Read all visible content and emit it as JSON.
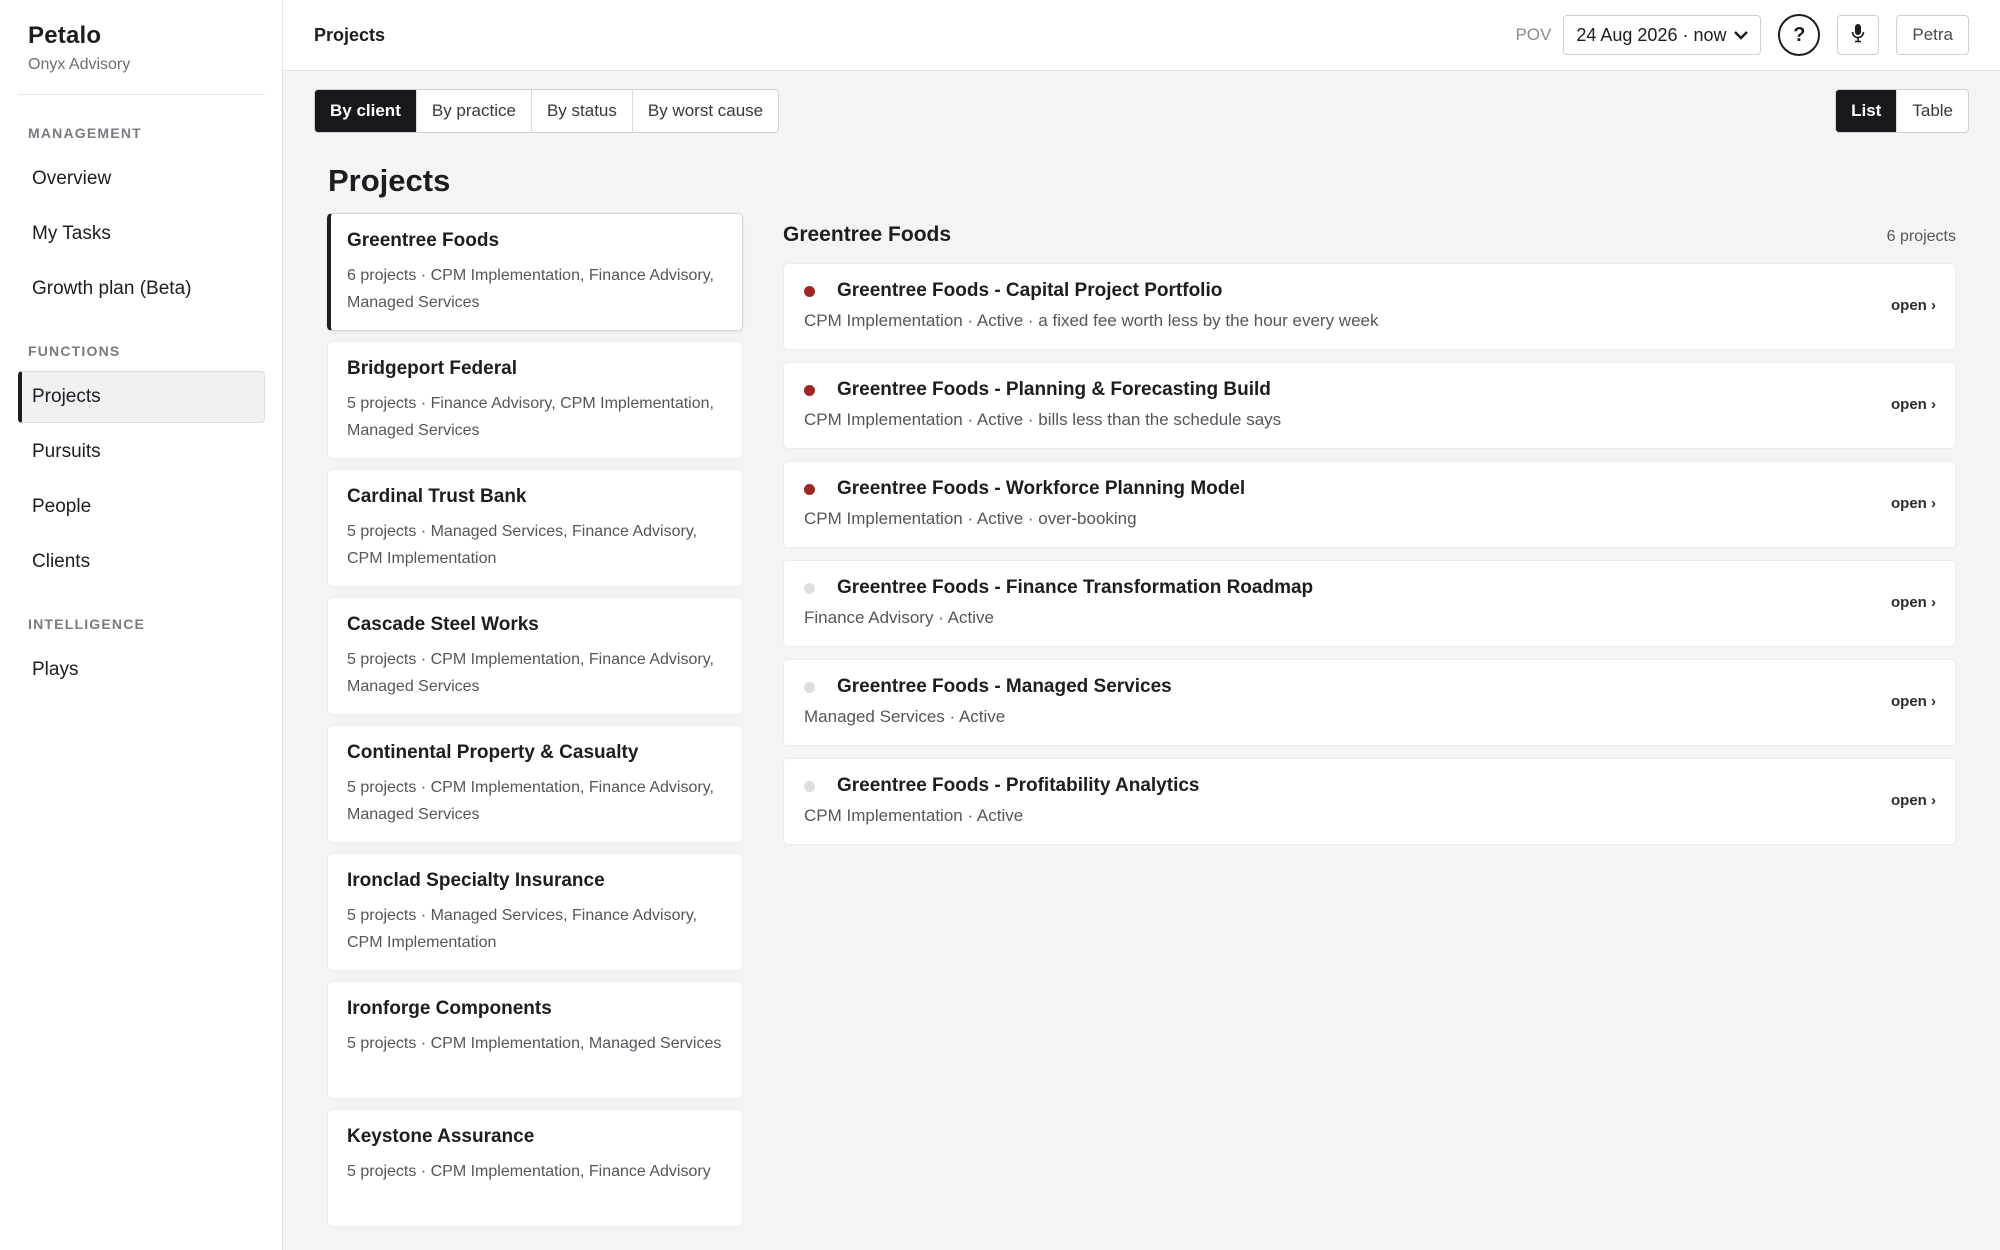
{
  "brand": {
    "name": "Petalo",
    "org": "Onyx Advisory"
  },
  "sidebar": {
    "sections": [
      {
        "title": "MANAGEMENT",
        "items": [
          "Overview",
          "My Tasks",
          "Growth plan (Beta)"
        ]
      },
      {
        "title": "FUNCTIONS",
        "items": [
          "Projects",
          "Pursuits",
          "People",
          "Clients"
        ]
      },
      {
        "title": "INTELLIGENCE",
        "items": [
          "Plays"
        ]
      }
    ],
    "active": "Projects"
  },
  "topbar": {
    "title": "Projects",
    "pov_label": "POV",
    "pov_value": "24 Aug 2026 · now",
    "help_label": "?",
    "user": "Petra"
  },
  "toolbar": {
    "group_tabs": [
      "By client",
      "By practice",
      "By status",
      "By worst cause"
    ],
    "group_active": "By client",
    "view_tabs": [
      "List",
      "Table"
    ],
    "view_active": "List"
  },
  "page_title": "Projects",
  "clients": [
    {
      "name": "Greentree Foods",
      "meta": "6 projects · CPM Implementation, Finance Advisory, Managed Services",
      "active": true
    },
    {
      "name": "Bridgeport Federal",
      "meta": "5 projects · Finance Advisory, CPM Implementation, Managed Services"
    },
    {
      "name": "Cardinal Trust Bank",
      "meta": "5 projects · Managed Services, Finance Advisory, CPM Implementation"
    },
    {
      "name": "Cascade Steel Works",
      "meta": "5 projects · CPM Implementation, Finance Advisory, Managed Services"
    },
    {
      "name": "Continental Property & Casualty",
      "meta": "5 projects · CPM Implementation, Finance Advisory, Managed Services"
    },
    {
      "name": "Ironclad Specialty Insurance",
      "meta": "5 projects · Managed Services, Finance Advisory, CPM Implementation"
    },
    {
      "name": "Ironforge Components",
      "meta": "5 projects · CPM Implementation, Managed Services"
    },
    {
      "name": "Keystone Assurance",
      "meta": "5 projects · CPM Implementation, Finance Advisory"
    }
  ],
  "detail": {
    "title": "Greentree Foods",
    "count": "6 projects",
    "open_label": "open ›",
    "projects": [
      {
        "name": "Greentree Foods - Capital Project Portfolio",
        "meta": "CPM Implementation · Active · a fixed fee worth less by the hour every week",
        "status": "red"
      },
      {
        "name": "Greentree Foods - Planning & Forecasting Build",
        "meta": "CPM Implementation · Active · bills less than the schedule says",
        "status": "red"
      },
      {
        "name": "Greentree Foods - Workforce Planning Model",
        "meta": "CPM Implementation · Active · over-booking",
        "status": "red"
      },
      {
        "name": "Greentree Foods - Finance Transformation Roadmap",
        "meta": "Finance Advisory · Active",
        "status": "grey"
      },
      {
        "name": "Greentree Foods - Managed Services",
        "meta": "Managed Services · Active",
        "status": "grey"
      },
      {
        "name": "Greentree Foods - Profitability Analytics",
        "meta": "CPM Implementation · Active",
        "status": "grey"
      }
    ]
  },
  "colors": {
    "accent": "#17181b",
    "alert": "#a4241f",
    "neutral_dot": "#dedee1",
    "background": "#f4f4f5"
  },
  "icons": {
    "help": "question-icon",
    "mic": "microphone-icon",
    "dropdown": "chevron-down-icon"
  }
}
